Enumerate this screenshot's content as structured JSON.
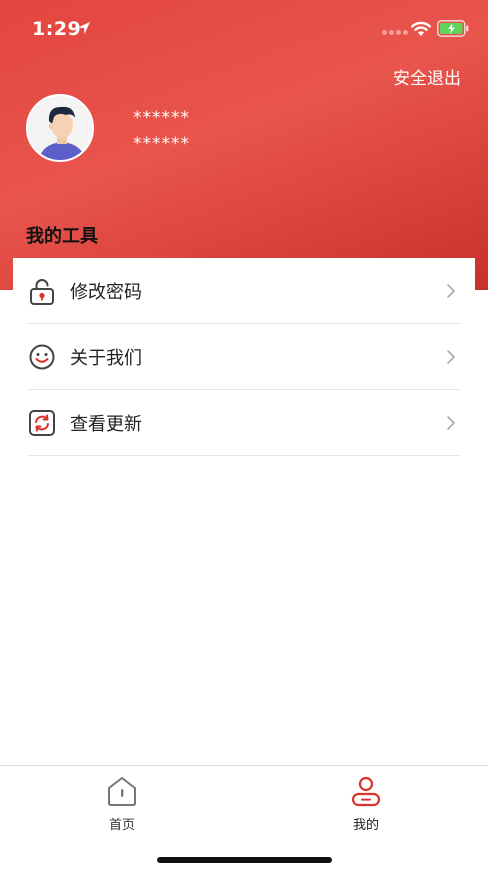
{
  "status_bar": {
    "time": "1:29"
  },
  "header": {
    "logout_label": "安全退出",
    "user_line_1": "******",
    "user_line_2": "******"
  },
  "section_title": "我的工具",
  "menu": [
    {
      "label": "修改密码",
      "icon": "lock-icon"
    },
    {
      "label": "关于我们",
      "icon": "smile-icon"
    },
    {
      "label": "查看更新",
      "icon": "refresh-icon"
    }
  ],
  "tabs": [
    {
      "label": "首页",
      "icon": "home-icon",
      "active": false
    },
    {
      "label": "我的",
      "icon": "user-icon",
      "active": true
    }
  ],
  "colors": {
    "accent": "#e2453f",
    "accent_dark": "#c8302b"
  }
}
